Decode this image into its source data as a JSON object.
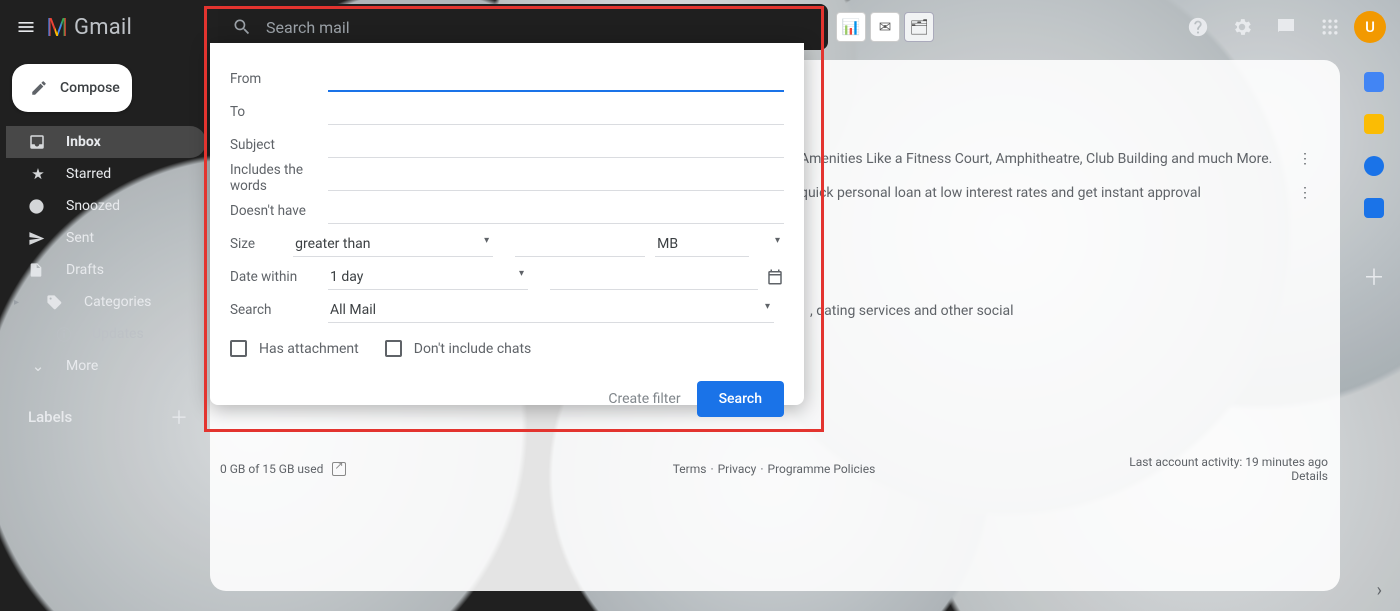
{
  "header": {
    "logo_text": "Gmail",
    "search_placeholder": "Search mail",
    "avatar_initial": "U"
  },
  "sidebar": {
    "compose": "Compose",
    "items": [
      {
        "label": "Inbox",
        "icon": "inbox"
      },
      {
        "label": "Starred",
        "icon": "star"
      },
      {
        "label": "Snoozed",
        "icon": "clock"
      },
      {
        "label": "Sent",
        "icon": "send"
      },
      {
        "label": "Drafts",
        "icon": "file"
      },
      {
        "label": "Categories",
        "icon": "tag"
      },
      {
        "label": "Updates",
        "icon": "info"
      },
      {
        "label": "More",
        "icon": "chev"
      }
    ],
    "labels_header": "Labels"
  },
  "search_options": {
    "fields": {
      "from": "From",
      "to": "To",
      "subject": "Subject",
      "includes": "Includes the words",
      "doesnt": "Doesn't have",
      "size": "Size",
      "date": "Date within",
      "search": "Search"
    },
    "size_op": "greater than",
    "size_unit": "MB",
    "date_range": "1 day",
    "search_in": "All Mail",
    "has_attachment": "Has attachment",
    "no_chats": "Don't include chats",
    "create_filter": "Create filter",
    "search_btn": "Search"
  },
  "rows": {
    "r1": "Amenities Like a Fitness Court, Amphitheatre, Club Building and much More.",
    "r2": "quick personal loan at low interest rates and get instant approval",
    "r3": ", dating services and other social"
  },
  "footer": {
    "storage": "0 GB of 15 GB used",
    "terms": "Terms",
    "privacy": "Privacy",
    "policies": "Programme Policies",
    "activity": "Last account activity: 19 minutes ago",
    "details": "Details"
  }
}
